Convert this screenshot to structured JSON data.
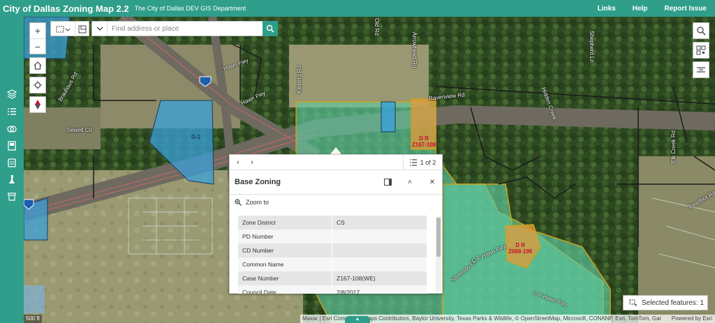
{
  "header": {
    "title": "City of Dallas Zoning Map 2.2",
    "subtitle": "The City of Dallas DEV GIS Department",
    "links": [
      "Links",
      "Help",
      "Report Issue"
    ]
  },
  "sidebar": {
    "icons": [
      "layers-icon",
      "legend-icon",
      "basemap-gallery-icon",
      "bookmark-icon",
      "print-icon",
      "measure-icon",
      "select-icon"
    ]
  },
  "search": {
    "placeholder": "Find address or place"
  },
  "map": {
    "street_labels": [
      "Hawn Fwy",
      "Hawn Fwy",
      "Kleberg Rd",
      "Arrowhead Rd",
      "Shepherd Ln",
      "Ravenview Rd",
      "Elk Creek Rd",
      "Sewell Cir",
      "Brauhaus Rd",
      "Silverado Dr",
      "C F Hawn Fwy",
      "C F Hawn Fwy",
      "Bearfoot Rd",
      "Hidden Creek",
      "Old Rd"
    ],
    "zone_labels": [
      {
        "l1": "D R",
        "l2": "Z167-108"
      },
      {
        "l1": "D R",
        "l2": "Z089-196"
      },
      {
        "l1": "D-1",
        "l2": ""
      }
    ],
    "scale": "500 ft",
    "attribution": "Maxar | Esri Community Maps Contributors, Baylor University, Texas Parks & Wildlife, © OpenStreetMap, Microsoft, CONANP, Esri, TomTom, Gar",
    "powered_by": "Powered by Esri"
  },
  "popup": {
    "feature_count": "1 of 2",
    "title": "Base Zoning",
    "zoom_to": "Zoom to",
    "attributes": [
      {
        "key": "Zone District",
        "value": "CS"
      },
      {
        "key": "PD Number",
        "value": ""
      },
      {
        "key": "CD Number",
        "value": ""
      },
      {
        "key": "Common Name",
        "value": ""
      },
      {
        "key": "Case Number",
        "value": "Z167-108(WE)"
      },
      {
        "key": "Council Date",
        "value": "2/8/2017"
      }
    ]
  },
  "selected_features": "Selected features: 1",
  "colors": {
    "brand": "#2f9e8a",
    "zone_green": "#5fc9a0",
    "zone_blue": "#3aa0d8",
    "zone_orange": "#e39a3a"
  }
}
